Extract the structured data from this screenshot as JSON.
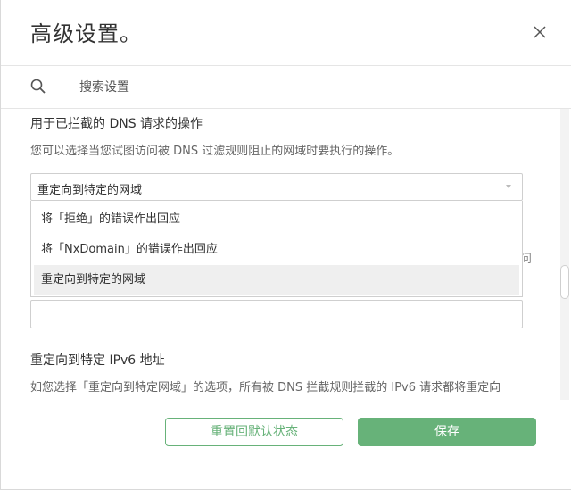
{
  "dialog": {
    "title": "高级设置。"
  },
  "search": {
    "placeholder": "搜索设置"
  },
  "blocked_dns": {
    "title": "用于已拦截的 DNS 请求的操作",
    "description": "您可以选择当您试图访问被 DNS 过滤规则阻止的网域时要执行的操作。",
    "selected_value": "重定向到特定的网域",
    "options": [
      "将「拒绝」的错误作出回应",
      "将「NxDomain」的错误作出回应",
      "重定向到特定的网域"
    ],
    "selected_index": 2
  },
  "partially_hidden_text": "问",
  "ipv6": {
    "title": "重定向到特定 IPv6 地址",
    "description": "如您选择「重定向到特定网域」的选项，所有被 DNS 拦截规则拦截的 IPv6 请求都将重定向"
  },
  "footer": {
    "reset_label": "重置回默认状态",
    "save_label": "保存"
  },
  "colors": {
    "accent": "#67b279",
    "selected_option_bg": "#efefef"
  },
  "icons": {
    "close": "close-icon",
    "search": "search-icon",
    "select_caret": "caret-down-icon"
  }
}
